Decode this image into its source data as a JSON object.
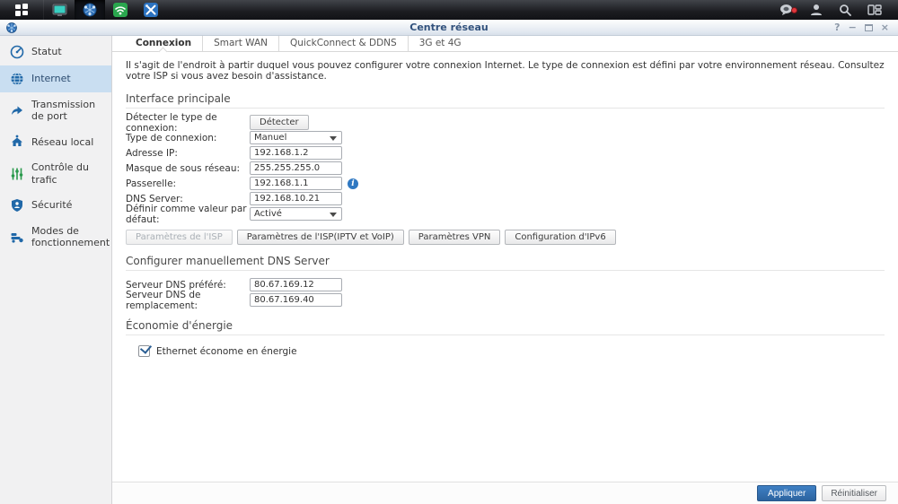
{
  "window": {
    "title": "Centre réseau",
    "controls": {
      "help": "?",
      "minimize": "−",
      "close": "×"
    }
  },
  "sidebar": {
    "items": [
      {
        "label": "Statut",
        "icon": "gauge-icon",
        "active": false
      },
      {
        "label": "Internet",
        "icon": "globe-icon",
        "active": true
      },
      {
        "label": "Transmission de port",
        "icon": "arrow-icon",
        "active": false
      },
      {
        "label": "Réseau local",
        "icon": "home-network-icon",
        "active": false
      },
      {
        "label": "Contrôle du trafic",
        "icon": "sliders-icon",
        "active": false
      },
      {
        "label": "Sécurité",
        "icon": "shield-icon",
        "active": false
      },
      {
        "label": "Modes de fonctionnement",
        "icon": "operation-modes-icon",
        "active": false
      }
    ]
  },
  "tabs": [
    {
      "label": "Connexion",
      "active": true
    },
    {
      "label": "Smart WAN",
      "active": false
    },
    {
      "label": "QuickConnect & DDNS",
      "active": false
    },
    {
      "label": "3G et 4G",
      "active": false
    }
  ],
  "main": {
    "description": "Il s'agit de l'endroit à partir duquel vous pouvez configurer votre connexion Internet. Le type de connexion est défini par votre environnement réseau. Consultez votre ISP si vous avez besoin d'assistance.",
    "section_interface": "Interface principale",
    "form": {
      "detect_label": "Détecter le type de connexion:",
      "detect_button": "Détecter",
      "type_label": "Type de connexion:",
      "type_value": "Manuel",
      "ip_label": "Adresse IP:",
      "ip_value": "192.168.1.2",
      "mask_label": "Masque de sous réseau:",
      "mask_value": "255.255.255.0",
      "gateway_label": "Passerelle:",
      "gateway_value": "192.168.1.1",
      "info_glyph": "i",
      "dns_label": "DNS Server:",
      "dns_value": "192.168.10.21",
      "default_label": "Définir comme valeur par défaut:",
      "default_value": "Activé"
    },
    "isp_buttons": [
      {
        "label": "Paramètres de l'ISP",
        "disabled": true
      },
      {
        "label": "Paramètres de l'ISP(IPTV et VoIP)",
        "disabled": false
      },
      {
        "label": "Paramètres VPN",
        "disabled": false
      },
      {
        "label": "Configuration d'IPv6",
        "disabled": false
      }
    ],
    "dns_section": {
      "title": "Configurer manuellement DNS Server",
      "preferred_label": "Serveur DNS préféré:",
      "preferred_value": "80.67.169.12",
      "alternate_label": "Serveur DNS de remplacement:",
      "alternate_value": "80.67.169.40"
    },
    "energy_section": {
      "title": "Économie d'énergie",
      "checkbox_label": "Ethernet économe en énergie",
      "checked": true
    }
  },
  "footer": {
    "apply": "Appliquer",
    "reset": "Réinitialiser"
  },
  "colors": {
    "accent": "#2068a8",
    "selection": "#c9def1",
    "primary_button": "#2c639f",
    "badge": "#e0383e"
  }
}
